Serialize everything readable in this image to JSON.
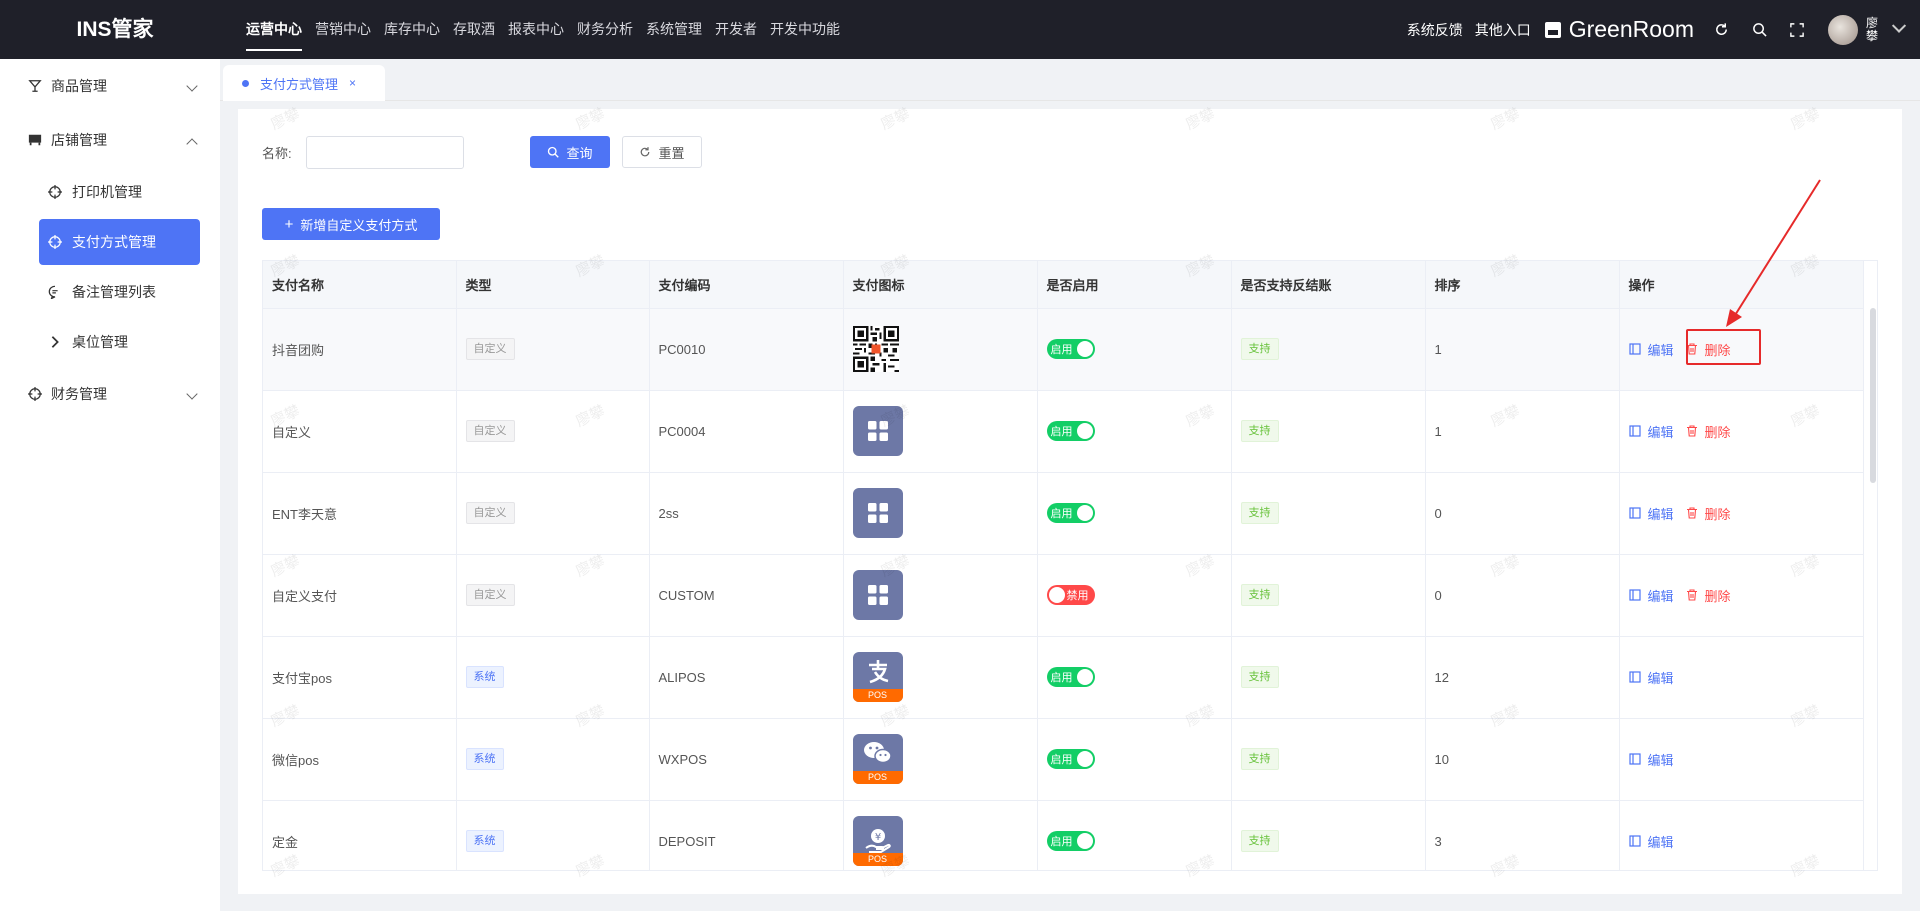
{
  "app": {
    "logo": "INS管家"
  },
  "nav": {
    "items": [
      "运营中心",
      "营销中心",
      "库存中心",
      "存取酒",
      "报表中心",
      "财务分析",
      "系统管理",
      "开发者",
      "开发中功能"
    ],
    "active_index": 0
  },
  "topright": {
    "feedback": "系统反馈",
    "other_entry": "其他入口",
    "store_name": "GreenRoom",
    "username": "廖攀"
  },
  "sidebar": {
    "goods": "商品管理",
    "shop": "店铺管理",
    "shop_items": [
      "打印机管理",
      "支付方式管理",
      "备注管理列表",
      "桌位管理"
    ],
    "active_sub": 1,
    "finance": "财务管理"
  },
  "tab": {
    "label": "支付方式管理",
    "close": "×"
  },
  "filter": {
    "name_label": "名称:",
    "name_value": "",
    "query_btn": "查询",
    "reset_btn": "重置"
  },
  "add_btn": "新增自定义支付方式",
  "table": {
    "headers": [
      "支付名称",
      "类型",
      "支付编码",
      "支付图标",
      "是否启用",
      "是否支持反结账",
      "排序",
      "操作"
    ],
    "rows": [
      {
        "name": "抖音团购",
        "type": "自定义",
        "type_kind": "custom",
        "code": "PC0010",
        "icon": "qr-code-icon",
        "enabled": true,
        "status_label": "启用",
        "refund": "支持",
        "sort": "1",
        "deletable": true
      },
      {
        "name": "自定义",
        "type": "自定义",
        "type_kind": "custom",
        "code": "PC0004",
        "icon": "grid-apps-icon",
        "enabled": true,
        "status_label": "启用",
        "refund": "支持",
        "sort": "1",
        "deletable": true
      },
      {
        "name": "ENT李天意",
        "type": "自定义",
        "type_kind": "custom",
        "code": "2ss",
        "icon": "grid-apps-icon",
        "enabled": true,
        "status_label": "启用",
        "refund": "支持",
        "sort": "0",
        "deletable": true
      },
      {
        "name": "自定义支付",
        "type": "自定义",
        "type_kind": "custom",
        "code": "CUSTOM",
        "icon": "grid-apps-icon",
        "enabled": false,
        "status_label": "禁用",
        "refund": "支持",
        "sort": "0",
        "deletable": true
      },
      {
        "name": "支付宝pos",
        "type": "系统",
        "type_kind": "system",
        "code": "ALIPOS",
        "icon": "alipay-pos-icon",
        "enabled": true,
        "status_label": "启用",
        "refund": "支持",
        "sort": "12",
        "deletable": false
      },
      {
        "name": "微信pos",
        "type": "系统",
        "type_kind": "system",
        "code": "WXPOS",
        "icon": "wechat-pos-icon",
        "enabled": true,
        "status_label": "启用",
        "refund": "支持",
        "sort": "10",
        "deletable": false
      },
      {
        "name": "定金",
        "type": "系统",
        "type_kind": "system",
        "code": "DEPOSIT",
        "icon": "deposit-hand-icon",
        "enabled": true,
        "status_label": "启用",
        "refund": "支持",
        "sort": "3",
        "deletable": false
      }
    ],
    "edit_label": "编辑",
    "delete_label": "删除",
    "pos_label": "POS"
  },
  "watermark": "廖攀",
  "colors": {
    "primary": "#4e74f5",
    "topbar": "#1f2029",
    "danger": "#ff4949",
    "success": "#13ce66",
    "pos_orange": "#ff6a00",
    "highlight": "#e62a2a"
  }
}
